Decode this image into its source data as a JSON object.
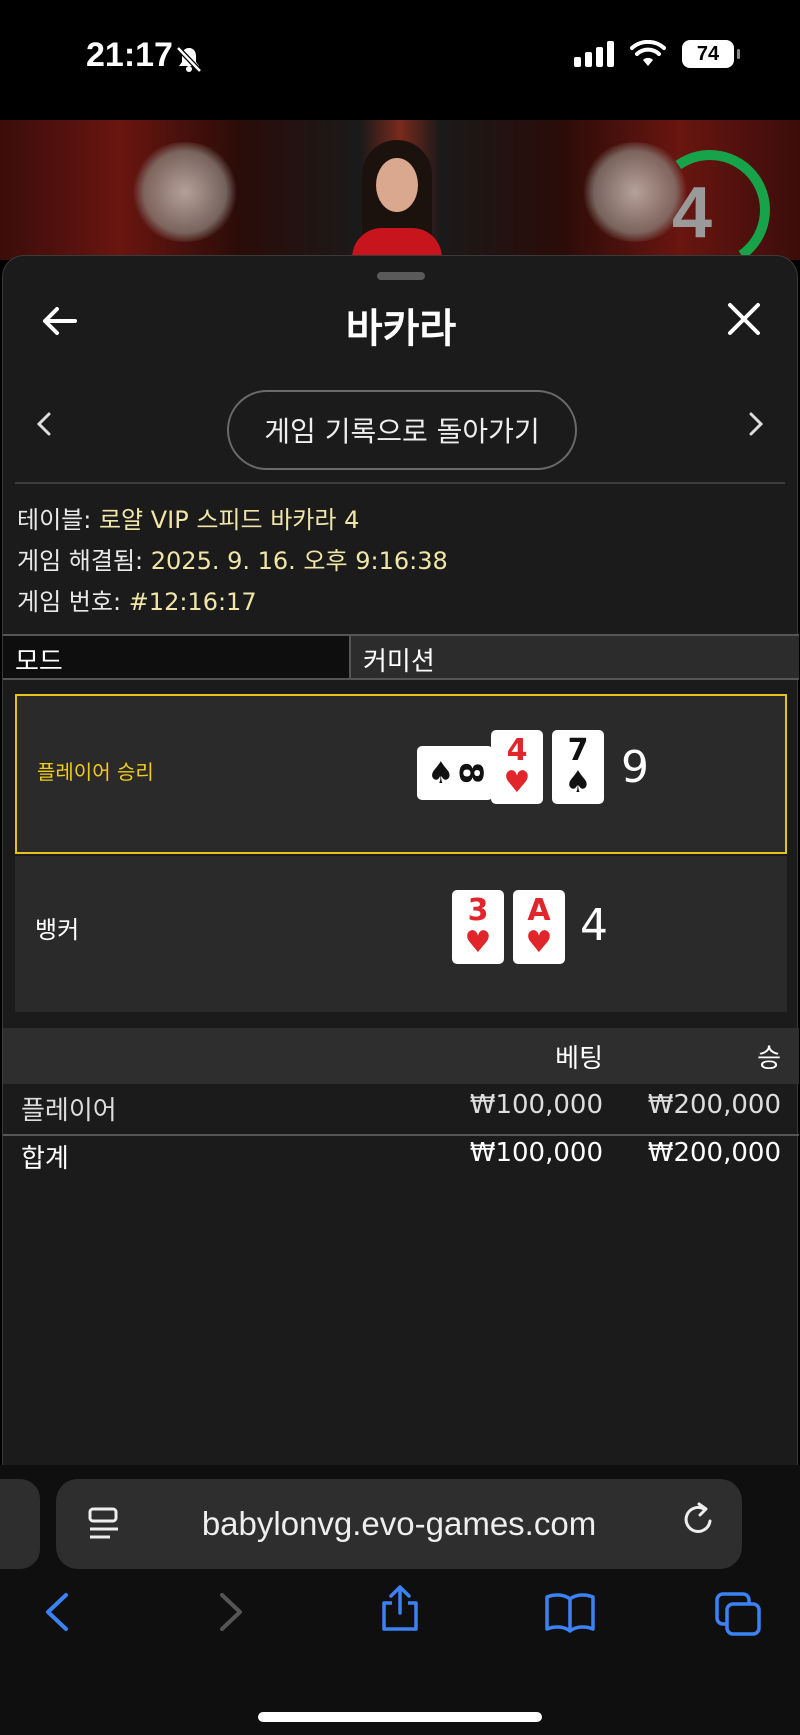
{
  "status": {
    "time": "21:17",
    "battery": "74"
  },
  "video": {
    "timer": "4"
  },
  "sheet": {
    "title": "바카라",
    "history_button": "게임 기록으로 돌아가기",
    "info": {
      "table_label": "테이블:",
      "table_value": "로얄 VIP 스피드 바카라 4",
      "resolved_label": "게임 해결됨:",
      "resolved_value": "2025. 9. 16. 오후 9:16:38",
      "game_no_label": "게임 번호:",
      "game_no_value": "#12:16:17"
    },
    "mode_label": "모드",
    "commission_label": "커미션",
    "player_result": {
      "label": "플레이어 승리",
      "score": "9",
      "cards": [
        {
          "rank": "8",
          "suit": "♠",
          "color": "#111111",
          "rotated": true
        },
        {
          "rank": "4",
          "suit": "♥",
          "color": "#e0252b"
        },
        {
          "rank": "7",
          "suit": "♠",
          "color": "#111111"
        }
      ]
    },
    "banker_result": {
      "label": "뱅커",
      "score": "4",
      "cards": [
        {
          "rank": "3",
          "suit": "♥",
          "color": "#e0252b"
        },
        {
          "rank": "A",
          "suit": "♥",
          "color": "#e0252b"
        }
      ]
    },
    "bets": {
      "header_bet": "베팅",
      "header_win": "승",
      "rows": [
        {
          "name": "플레이어",
          "bet": "₩100,000",
          "win": "₩200,000"
        }
      ],
      "total": {
        "name": "합계",
        "bet": "₩100,000",
        "win": "₩200,000"
      }
    },
    "accent_color": "#e8c21c"
  },
  "browser": {
    "url": "babylonvg.evo-games.com",
    "icons": [
      "back-icon",
      "forward-icon",
      "share-icon",
      "bookmarks-icon",
      "tabs-icon"
    ]
  }
}
